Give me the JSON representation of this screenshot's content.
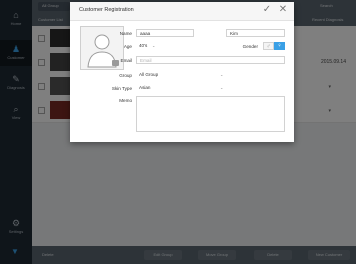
{
  "nav": {
    "items": [
      {
        "label": "Home",
        "icon": "home-icon"
      },
      {
        "label": "Customer",
        "icon": "customer-icon"
      },
      {
        "label": "Diagnosis",
        "icon": "diagnosis-icon"
      },
      {
        "label": "View",
        "icon": "search-icon"
      },
      {
        "label": "Settings",
        "icon": "gear-icon"
      }
    ],
    "active_index": 1
  },
  "topbar": {
    "tabs": [
      "All Group",
      "Search"
    ]
  },
  "table": {
    "headers": [
      "Customer List",
      "Name",
      "Recent Diagnosis"
    ],
    "rows": [
      {
        "date": "",
        "thumb_color": "#2d2d2d"
      },
      {
        "date": "2015.09.14",
        "thumb_color": "#444444"
      },
      {
        "date": "",
        "thumb_color": "#555555"
      },
      {
        "date": "",
        "thumb_color": "#7a2a24"
      }
    ]
  },
  "footer": {
    "left_label": "Delete",
    "buttons": [
      "Edit Group",
      "Move Group",
      "Delete",
      "New Customer"
    ]
  },
  "dialog": {
    "title": "Customer Registration",
    "confirm_icon": "checkmark-icon",
    "close_icon": "close-icon",
    "labels": {
      "name": "Name",
      "age": "Age",
      "gender": "Gender",
      "email": "Email",
      "group": "Group",
      "skin_type": "Skin Type",
      "memo": "Memo"
    },
    "fields": {
      "first_name": "aaaa",
      "last_name": "Kim",
      "age": "40's",
      "email_placeholder": "Email",
      "group": "All Group",
      "skin_type": "Asian",
      "memo": ""
    },
    "gender_selected": "female",
    "accent": "#3aa0e6"
  }
}
